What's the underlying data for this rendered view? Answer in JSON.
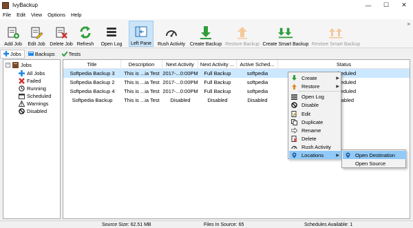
{
  "window": {
    "title": "IvyBackup",
    "minimize": "—",
    "maximize": "☐",
    "close": "✕"
  },
  "menu": [
    "File",
    "Edit",
    "View",
    "Options",
    "Help"
  ],
  "toolbar": {
    "add_job": "Add Job",
    "edit_job": "Edit Job",
    "delete_job": "Delete Job",
    "refresh": "Refresh",
    "open_log": "Open Log",
    "left_pane": "Left Pane",
    "rush_activity": "Rush Activity",
    "create_backup": "Create Backup",
    "restore_backup": "Restore Backup",
    "create_smart_backup": "Create Smart Backup",
    "restore_smart_backup": "Restore Smart Backup",
    "overflow": "»"
  },
  "tabs": [
    "Jobs",
    "Backups",
    "Tests"
  ],
  "tree": {
    "root": "Jobs",
    "items": [
      "All Jobs",
      "Failed",
      "Running",
      "Scheduled",
      "Warnings",
      "Disabled"
    ]
  },
  "grid": {
    "columns": [
      "Title",
      "Description",
      "Next Activity",
      "Next Activity ...",
      "Active Sched...",
      "Status"
    ],
    "rows": [
      {
        "title": "Softpedia Backup 3",
        "description": "This is ...ia Test",
        "next_activity": "2017-...0:00PM",
        "next_activity_type": "Full Backup",
        "active_schedule": "softpedia",
        "status": "Scheduled"
      },
      {
        "title": "Softpedia Backup 2",
        "description": "This is ...ia Test",
        "next_activity": "2017-...0:00PM",
        "next_activity_type": "Full Backup",
        "active_schedule": "softpedia",
        "status": "Scheduled"
      },
      {
        "title": "Softpedia Backup 4",
        "description": "This is ...ia Test",
        "next_activity": "2017-...0:00PM",
        "next_activity_type": "Full Backup",
        "active_schedule": "softpedia",
        "status": "Scheduled"
      },
      {
        "title": "Softpedia Backup",
        "description": "This is ...ia Test",
        "next_activity": "Disabled",
        "next_activity_type": "Disabled",
        "active_schedule": "Disabled",
        "status": "Disabled"
      }
    ]
  },
  "context_menu": {
    "items": [
      "Create",
      "Restore",
      "Open Log",
      "Disable",
      "Edit",
      "Duplicate",
      "Rename",
      "Delete",
      "Rush Activity",
      "Locations"
    ],
    "arrow": "▶"
  },
  "submenu": {
    "items": [
      "Open Destination",
      "Open Source"
    ]
  },
  "status": {
    "source_size": "Source Size: 62.51 MB",
    "files_in_source": "Files In Source: 65",
    "schedules_available": "Schedules Available: 1"
  },
  "colors": {
    "accent_blue": "#1e88e5",
    "green": "#2e9e3a",
    "red": "#d32f2f",
    "selection": "#cce8ff",
    "menu_hover": "#91c9f7"
  }
}
